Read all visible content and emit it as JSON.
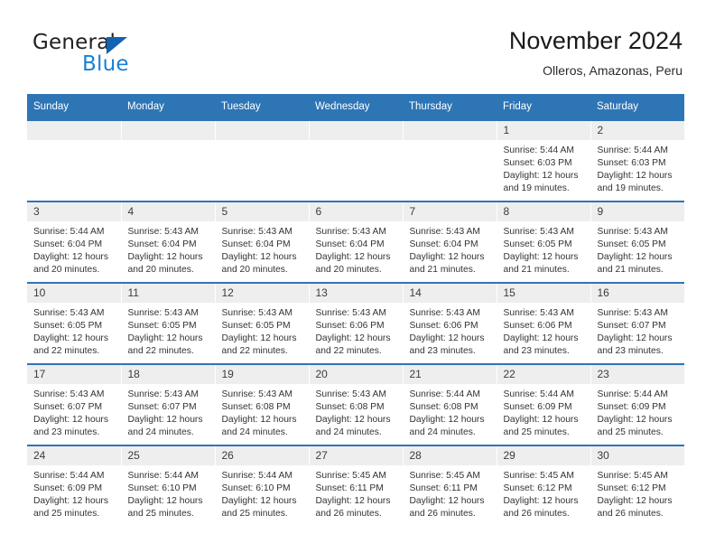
{
  "brand": {
    "name_top": "General",
    "name_bottom": "Blue",
    "triangle_color": "#1263b0",
    "blue_color": "#1a7fd4"
  },
  "header": {
    "title": "November 2024",
    "subtitle": "Olleros, Amazonas, Peru"
  },
  "theme": {
    "header_blue": "#2e75b6",
    "daynum_bg": "#eeeeee"
  },
  "columns": [
    "Sunday",
    "Monday",
    "Tuesday",
    "Wednesday",
    "Thursday",
    "Friday",
    "Saturday"
  ],
  "weeks": [
    [
      {
        "day": "",
        "lines": []
      },
      {
        "day": "",
        "lines": []
      },
      {
        "day": "",
        "lines": []
      },
      {
        "day": "",
        "lines": []
      },
      {
        "day": "",
        "lines": []
      },
      {
        "day": "1",
        "lines": [
          "Sunrise: 5:44 AM",
          "Sunset: 6:03 PM",
          "Daylight: 12 hours",
          "and 19 minutes."
        ]
      },
      {
        "day": "2",
        "lines": [
          "Sunrise: 5:44 AM",
          "Sunset: 6:03 PM",
          "Daylight: 12 hours",
          "and 19 minutes."
        ]
      }
    ],
    [
      {
        "day": "3",
        "lines": [
          "Sunrise: 5:44 AM",
          "Sunset: 6:04 PM",
          "Daylight: 12 hours",
          "and 20 minutes."
        ]
      },
      {
        "day": "4",
        "lines": [
          "Sunrise: 5:43 AM",
          "Sunset: 6:04 PM",
          "Daylight: 12 hours",
          "and 20 minutes."
        ]
      },
      {
        "day": "5",
        "lines": [
          "Sunrise: 5:43 AM",
          "Sunset: 6:04 PM",
          "Daylight: 12 hours",
          "and 20 minutes."
        ]
      },
      {
        "day": "6",
        "lines": [
          "Sunrise: 5:43 AM",
          "Sunset: 6:04 PM",
          "Daylight: 12 hours",
          "and 20 minutes."
        ]
      },
      {
        "day": "7",
        "lines": [
          "Sunrise: 5:43 AM",
          "Sunset: 6:04 PM",
          "Daylight: 12 hours",
          "and 21 minutes."
        ]
      },
      {
        "day": "8",
        "lines": [
          "Sunrise: 5:43 AM",
          "Sunset: 6:05 PM",
          "Daylight: 12 hours",
          "and 21 minutes."
        ]
      },
      {
        "day": "9",
        "lines": [
          "Sunrise: 5:43 AM",
          "Sunset: 6:05 PM",
          "Daylight: 12 hours",
          "and 21 minutes."
        ]
      }
    ],
    [
      {
        "day": "10",
        "lines": [
          "Sunrise: 5:43 AM",
          "Sunset: 6:05 PM",
          "Daylight: 12 hours",
          "and 22 minutes."
        ]
      },
      {
        "day": "11",
        "lines": [
          "Sunrise: 5:43 AM",
          "Sunset: 6:05 PM",
          "Daylight: 12 hours",
          "and 22 minutes."
        ]
      },
      {
        "day": "12",
        "lines": [
          "Sunrise: 5:43 AM",
          "Sunset: 6:05 PM",
          "Daylight: 12 hours",
          "and 22 minutes."
        ]
      },
      {
        "day": "13",
        "lines": [
          "Sunrise: 5:43 AM",
          "Sunset: 6:06 PM",
          "Daylight: 12 hours",
          "and 22 minutes."
        ]
      },
      {
        "day": "14",
        "lines": [
          "Sunrise: 5:43 AM",
          "Sunset: 6:06 PM",
          "Daylight: 12 hours",
          "and 23 minutes."
        ]
      },
      {
        "day": "15",
        "lines": [
          "Sunrise: 5:43 AM",
          "Sunset: 6:06 PM",
          "Daylight: 12 hours",
          "and 23 minutes."
        ]
      },
      {
        "day": "16",
        "lines": [
          "Sunrise: 5:43 AM",
          "Sunset: 6:07 PM",
          "Daylight: 12 hours",
          "and 23 minutes."
        ]
      }
    ],
    [
      {
        "day": "17",
        "lines": [
          "Sunrise: 5:43 AM",
          "Sunset: 6:07 PM",
          "Daylight: 12 hours",
          "and 23 minutes."
        ]
      },
      {
        "day": "18",
        "lines": [
          "Sunrise: 5:43 AM",
          "Sunset: 6:07 PM",
          "Daylight: 12 hours",
          "and 24 minutes."
        ]
      },
      {
        "day": "19",
        "lines": [
          "Sunrise: 5:43 AM",
          "Sunset: 6:08 PM",
          "Daylight: 12 hours",
          "and 24 minutes."
        ]
      },
      {
        "day": "20",
        "lines": [
          "Sunrise: 5:43 AM",
          "Sunset: 6:08 PM",
          "Daylight: 12 hours",
          "and 24 minutes."
        ]
      },
      {
        "day": "21",
        "lines": [
          "Sunrise: 5:44 AM",
          "Sunset: 6:08 PM",
          "Daylight: 12 hours",
          "and 24 minutes."
        ]
      },
      {
        "day": "22",
        "lines": [
          "Sunrise: 5:44 AM",
          "Sunset: 6:09 PM",
          "Daylight: 12 hours",
          "and 25 minutes."
        ]
      },
      {
        "day": "23",
        "lines": [
          "Sunrise: 5:44 AM",
          "Sunset: 6:09 PM",
          "Daylight: 12 hours",
          "and 25 minutes."
        ]
      }
    ],
    [
      {
        "day": "24",
        "lines": [
          "Sunrise: 5:44 AM",
          "Sunset: 6:09 PM",
          "Daylight: 12 hours",
          "and 25 minutes."
        ]
      },
      {
        "day": "25",
        "lines": [
          "Sunrise: 5:44 AM",
          "Sunset: 6:10 PM",
          "Daylight: 12 hours",
          "and 25 minutes."
        ]
      },
      {
        "day": "26",
        "lines": [
          "Sunrise: 5:44 AM",
          "Sunset: 6:10 PM",
          "Daylight: 12 hours",
          "and 25 minutes."
        ]
      },
      {
        "day": "27",
        "lines": [
          "Sunrise: 5:45 AM",
          "Sunset: 6:11 PM",
          "Daylight: 12 hours",
          "and 26 minutes."
        ]
      },
      {
        "day": "28",
        "lines": [
          "Sunrise: 5:45 AM",
          "Sunset: 6:11 PM",
          "Daylight: 12 hours",
          "and 26 minutes."
        ]
      },
      {
        "day": "29",
        "lines": [
          "Sunrise: 5:45 AM",
          "Sunset: 6:12 PM",
          "Daylight: 12 hours",
          "and 26 minutes."
        ]
      },
      {
        "day": "30",
        "lines": [
          "Sunrise: 5:45 AM",
          "Sunset: 6:12 PM",
          "Daylight: 12 hours",
          "and 26 minutes."
        ]
      }
    ]
  ]
}
